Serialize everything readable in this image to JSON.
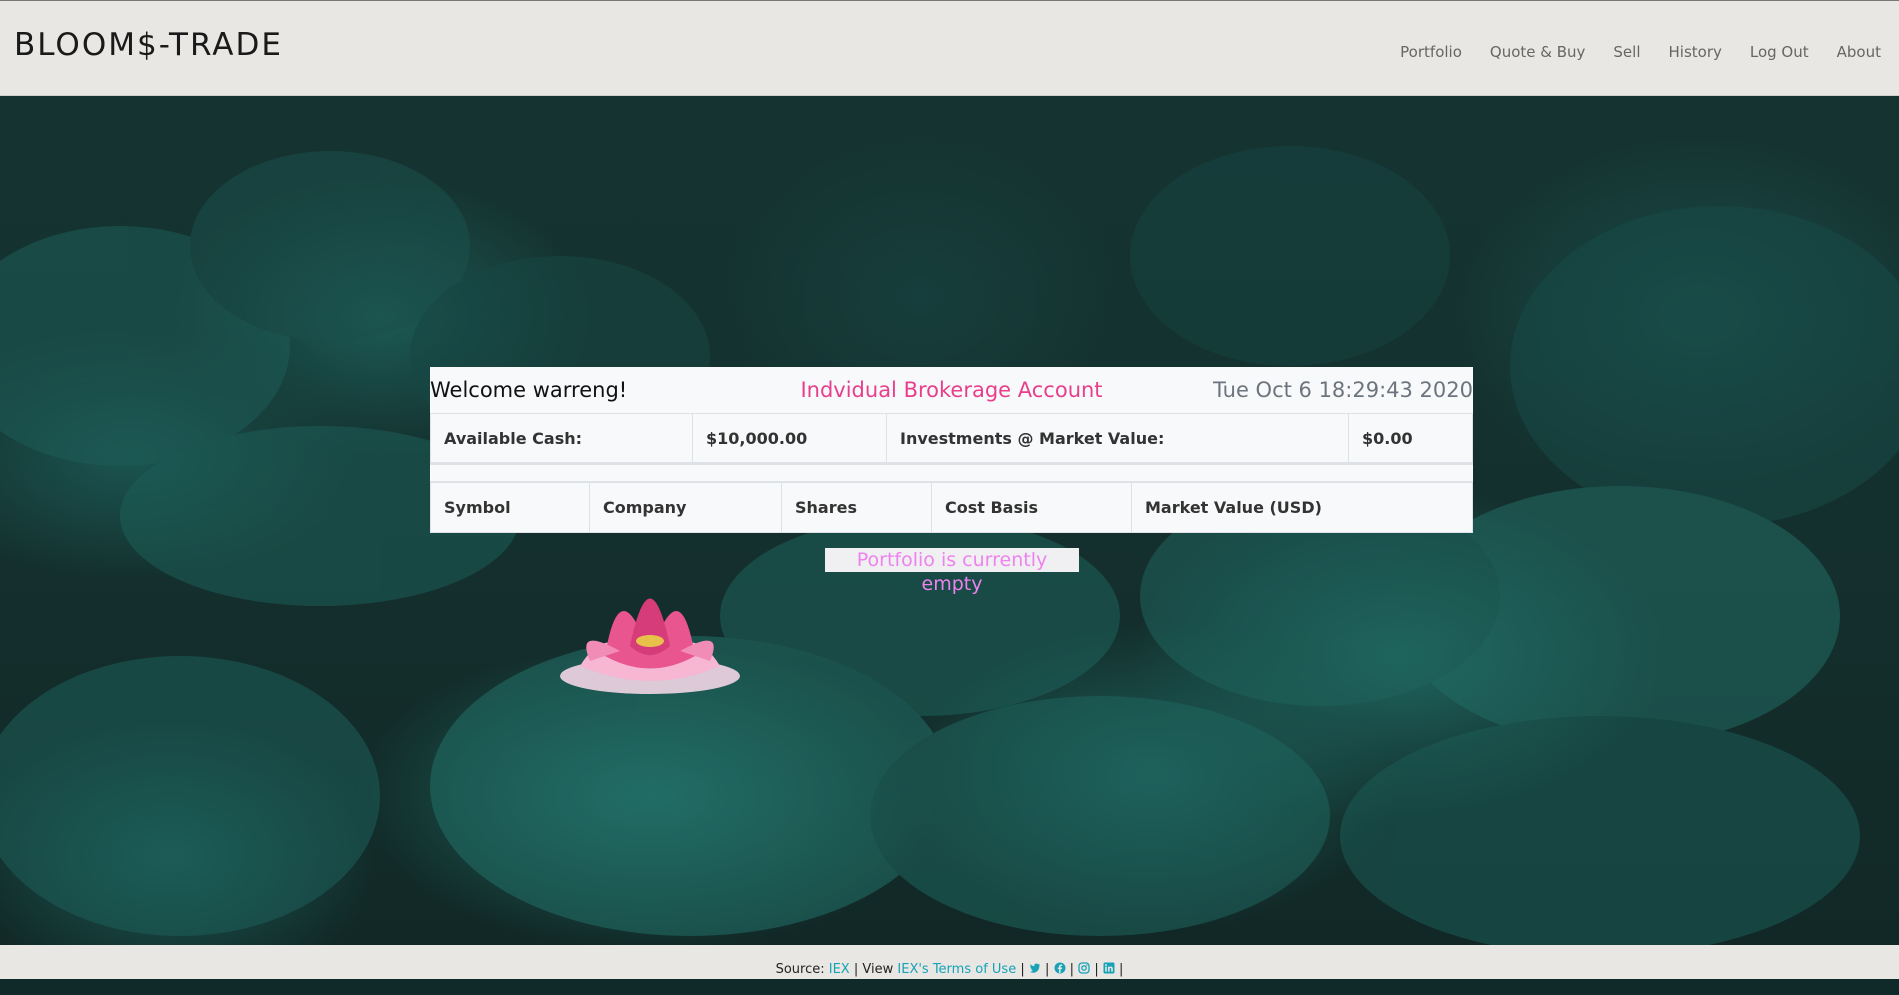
{
  "navbar": {
    "brand": "BLOOM$-TRADE",
    "links": [
      "Portfolio",
      "Quote & Buy",
      "Sell",
      "History",
      "Log Out",
      "About"
    ]
  },
  "account": {
    "welcome": "Welcome warreng!",
    "account_type": "Indvidual Brokerage Account",
    "datetime": "Tue Oct 6 18:29:43 2020"
  },
  "summary": {
    "cash_label": "Available Cash:",
    "cash_value": "$10,000.00",
    "investments_label": "Investments @ Market Value:",
    "investments_value": "$0.00"
  },
  "holdings": {
    "columns": [
      "Symbol",
      "Company",
      "Shares",
      "Cost Basis",
      "Market Value (USD)"
    ],
    "empty_message": "Portfolio is currently empty"
  },
  "footer": {
    "source_label": "Source:",
    "source_link": "IEX",
    "view_label": "View",
    "terms_link": "IEX's Terms of Use",
    "social_icons": [
      "twitter-icon",
      "facebook-icon",
      "instagram-icon",
      "linkedin-icon"
    ]
  },
  "colors": {
    "accent_pink": "#e83e8c",
    "link_teal": "#17a2b8",
    "empty_text": "#ee82ee",
    "navbar_bg": "#e8e7e3"
  }
}
